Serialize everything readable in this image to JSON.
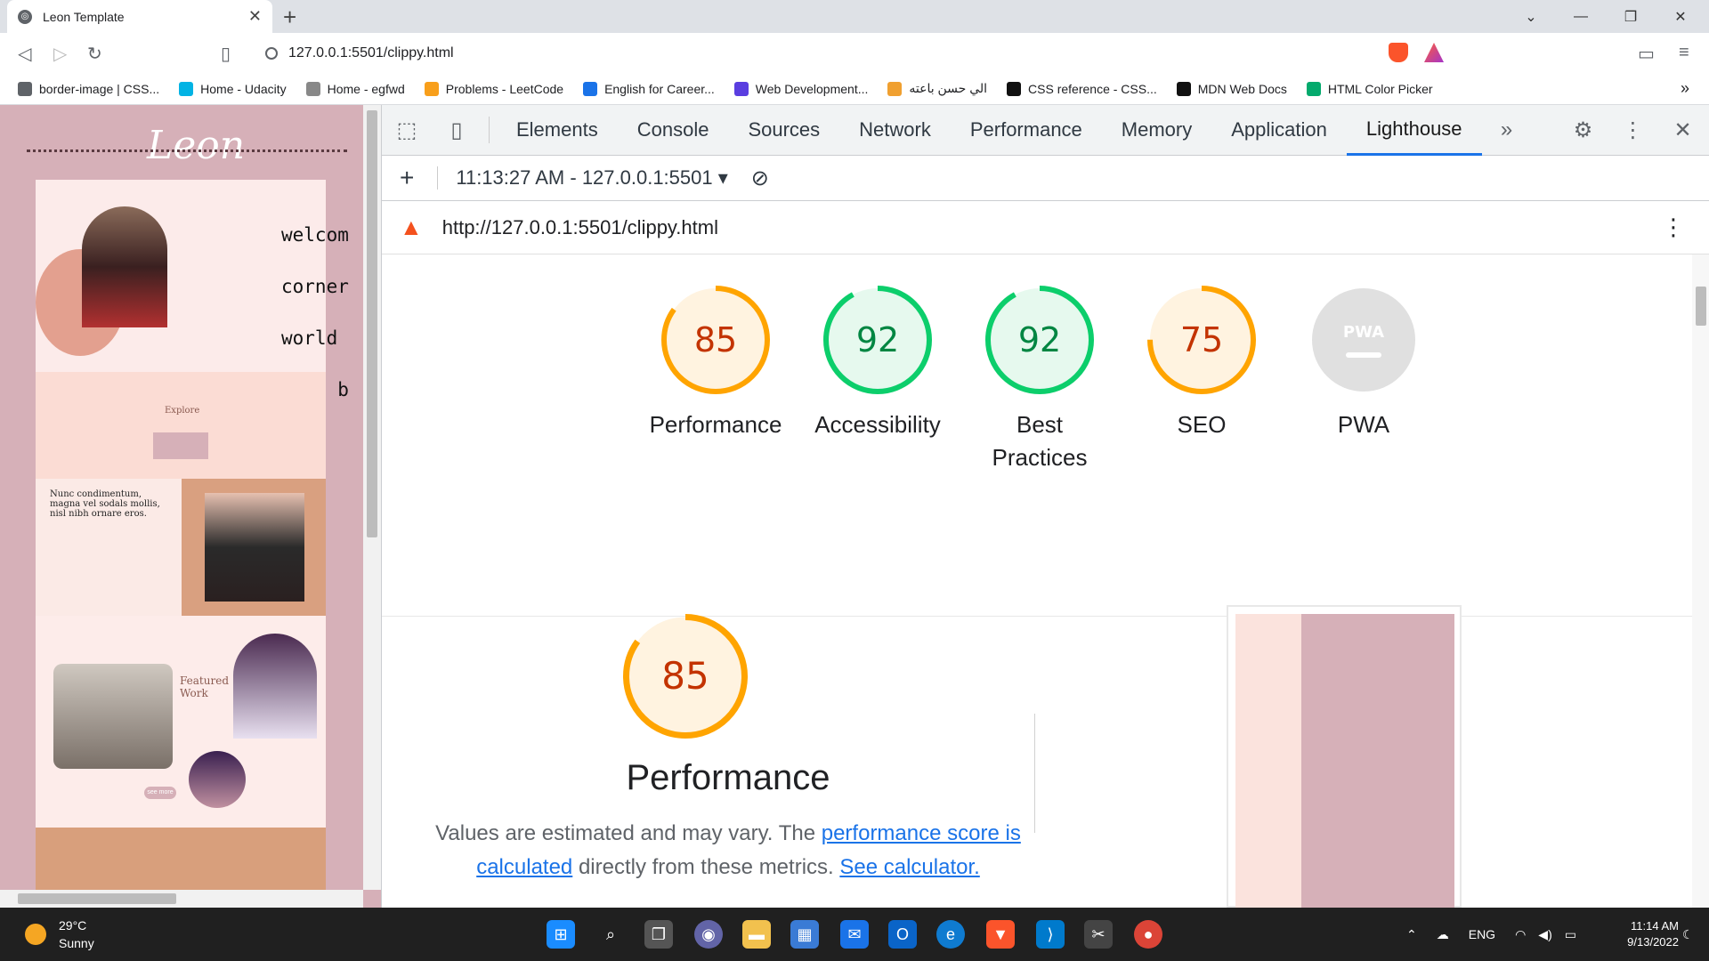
{
  "browser": {
    "tab_title": "Leon Template",
    "url": "127.0.0.1:5501/clippy.html",
    "bookmarks": [
      {
        "label": "border-image | CSS...",
        "color": "#5f6368"
      },
      {
        "label": "Home - Udacity",
        "color": "#02b3e4"
      },
      {
        "label": "Home - egfwd",
        "color": "#888888"
      },
      {
        "label": "Problems - LeetCode",
        "color": "#f89f1b"
      },
      {
        "label": "English for Career...",
        "color": "#1a73e8"
      },
      {
        "label": "Web Development...",
        "color": "#5a3ee0"
      },
      {
        "label": "الي حسن باعته",
        "color": "#f0a030"
      },
      {
        "label": "CSS reference - CSS...",
        "color": "#111111"
      },
      {
        "label": "MDN Web Docs",
        "color": "#111111"
      },
      {
        "label": "HTML Color Picker",
        "color": "#04aa6d"
      }
    ],
    "more_bookmarks": "»"
  },
  "preview": {
    "logo": "Leon",
    "welcome_lines": [
      "welcom",
      "corner",
      "world",
      "more b"
    ],
    "explore_label": "Explore",
    "feature_text": "Nunc condimentum, magna vel sodals mollis, nisl nibh ornare eros.",
    "work_label_1": "Featured",
    "work_label_2": "Work",
    "see_more": "see more"
  },
  "devtools": {
    "tabs": [
      "Elements",
      "Console",
      "Sources",
      "Network",
      "Performance",
      "Memory",
      "Application",
      "Lighthouse"
    ],
    "active_tab": "Lighthouse",
    "report_selector": "11:13:27 AM - 127.0.0.1:5501",
    "report_url": "http://127.0.0.1:5501/clippy.html"
  },
  "lighthouse": {
    "scores": [
      {
        "label": "Performance",
        "value": "85",
        "color": "#ffa400",
        "text_color": "#c33300",
        "fill": "#fff3e0",
        "fraction": 0.85
      },
      {
        "label": "Accessibility",
        "value": "92",
        "color": "#0cce6b",
        "text_color": "#018642",
        "fill": "#e6f9ee",
        "fraction": 0.92
      },
      {
        "label": "Best Practices",
        "value": "92",
        "color": "#0cce6b",
        "text_color": "#018642",
        "fill": "#e6f9ee",
        "fraction": 0.92
      },
      {
        "label": "SEO",
        "value": "75",
        "color": "#ffa400",
        "text_color": "#c33300",
        "fill": "#fff3e0",
        "fraction": 0.75
      },
      {
        "label": "PWA",
        "value": "PWA",
        "color": "#e0e0e0",
        "text_color": "#9e9e9e",
        "fill": "#e0e0e0",
        "fraction": 0
      }
    ],
    "detail": {
      "score": "85",
      "title": "Performance",
      "desc_1": "Values are estimated and may vary. The",
      "link_1": "performance score is calculated",
      "desc_2": "directly from these metrics.",
      "link_2": "See calculator."
    }
  },
  "taskbar": {
    "temperature": "29°C",
    "condition": "Sunny",
    "language": "ENG",
    "time": "11:14 AM",
    "date": "9/13/2022"
  }
}
